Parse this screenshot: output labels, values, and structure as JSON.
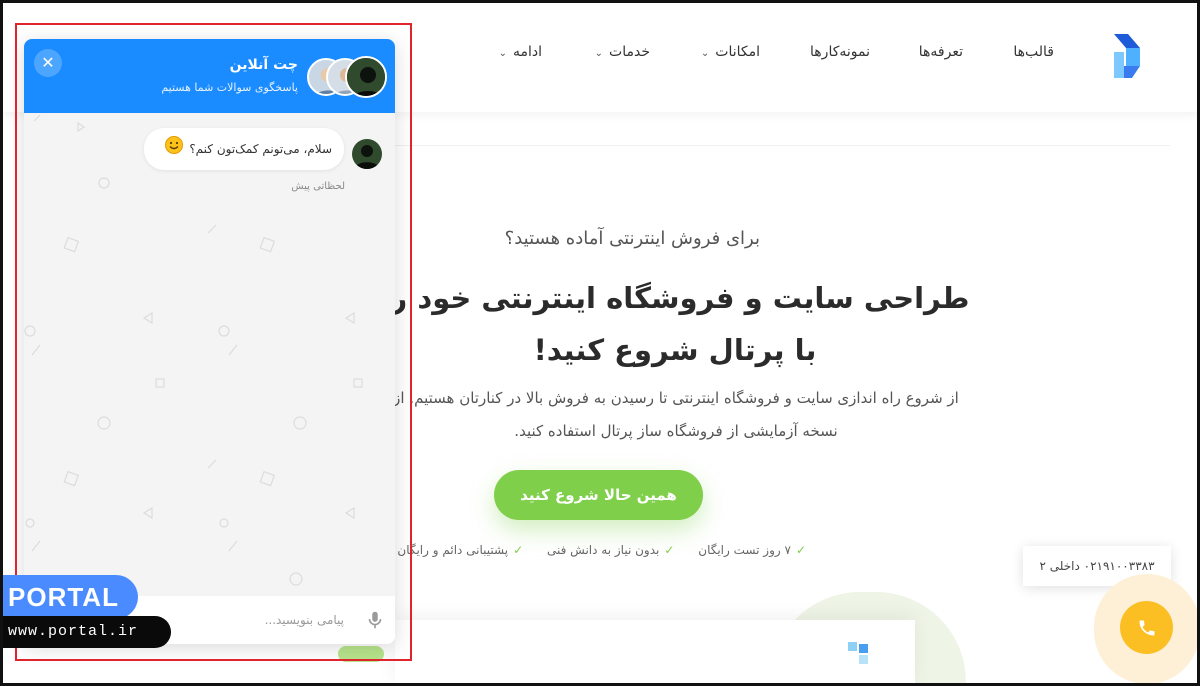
{
  "nav": {
    "items": [
      {
        "label": "قالب‌ها",
        "dropdown": false
      },
      {
        "label": "تعرفه‌ها",
        "dropdown": false
      },
      {
        "label": "نمونه‌کارها",
        "dropdown": false
      },
      {
        "label": "امکانات",
        "dropdown": true
      },
      {
        "label": "خدمات",
        "dropdown": true
      },
      {
        "label": "ادامه",
        "dropdown": true
      }
    ]
  },
  "hero": {
    "subtitle": "برای فروش اینترنتی آماده هستید؟",
    "title": "طراحی سایت و فروشگاه اینترنتی خود را با پرتال شروع کنید!",
    "description": "از شروع راه اندازی سایت و فروشگاه اینترنتی تا رسیدن به فروش بالا در کنارتان هستیم. از نسخه آزمایشی از فروشگاه ساز پرتال استفاده کنید.",
    "cta_label": "همین حالا شروع کنید",
    "features": [
      "۷ روز تست رایگان",
      "بدون نیاز به دانش فنی",
      "پشتیبانی دائم و رایگان"
    ]
  },
  "contact": {
    "phone_text": "۰۲۱۹۱۰۰۳۳۸۳ داخلی ۲"
  },
  "chat": {
    "title": "چت آنلاین",
    "subtitle": "پاسخگوی سوالات شما هستیم",
    "message": "سلام، می‌تونم کمک‌تون کنم؟",
    "message_time": "لحظاتی پیش",
    "input_placeholder": "پیامی بنویسید..."
  },
  "watermark": {
    "brand": "PORTAL",
    "url": "www.portal.ir"
  },
  "colors": {
    "chat_header": "#1a8cff",
    "cta": "#7fcf4a",
    "call_button": "#fbbf24",
    "highlight_box": "#e0242b"
  }
}
